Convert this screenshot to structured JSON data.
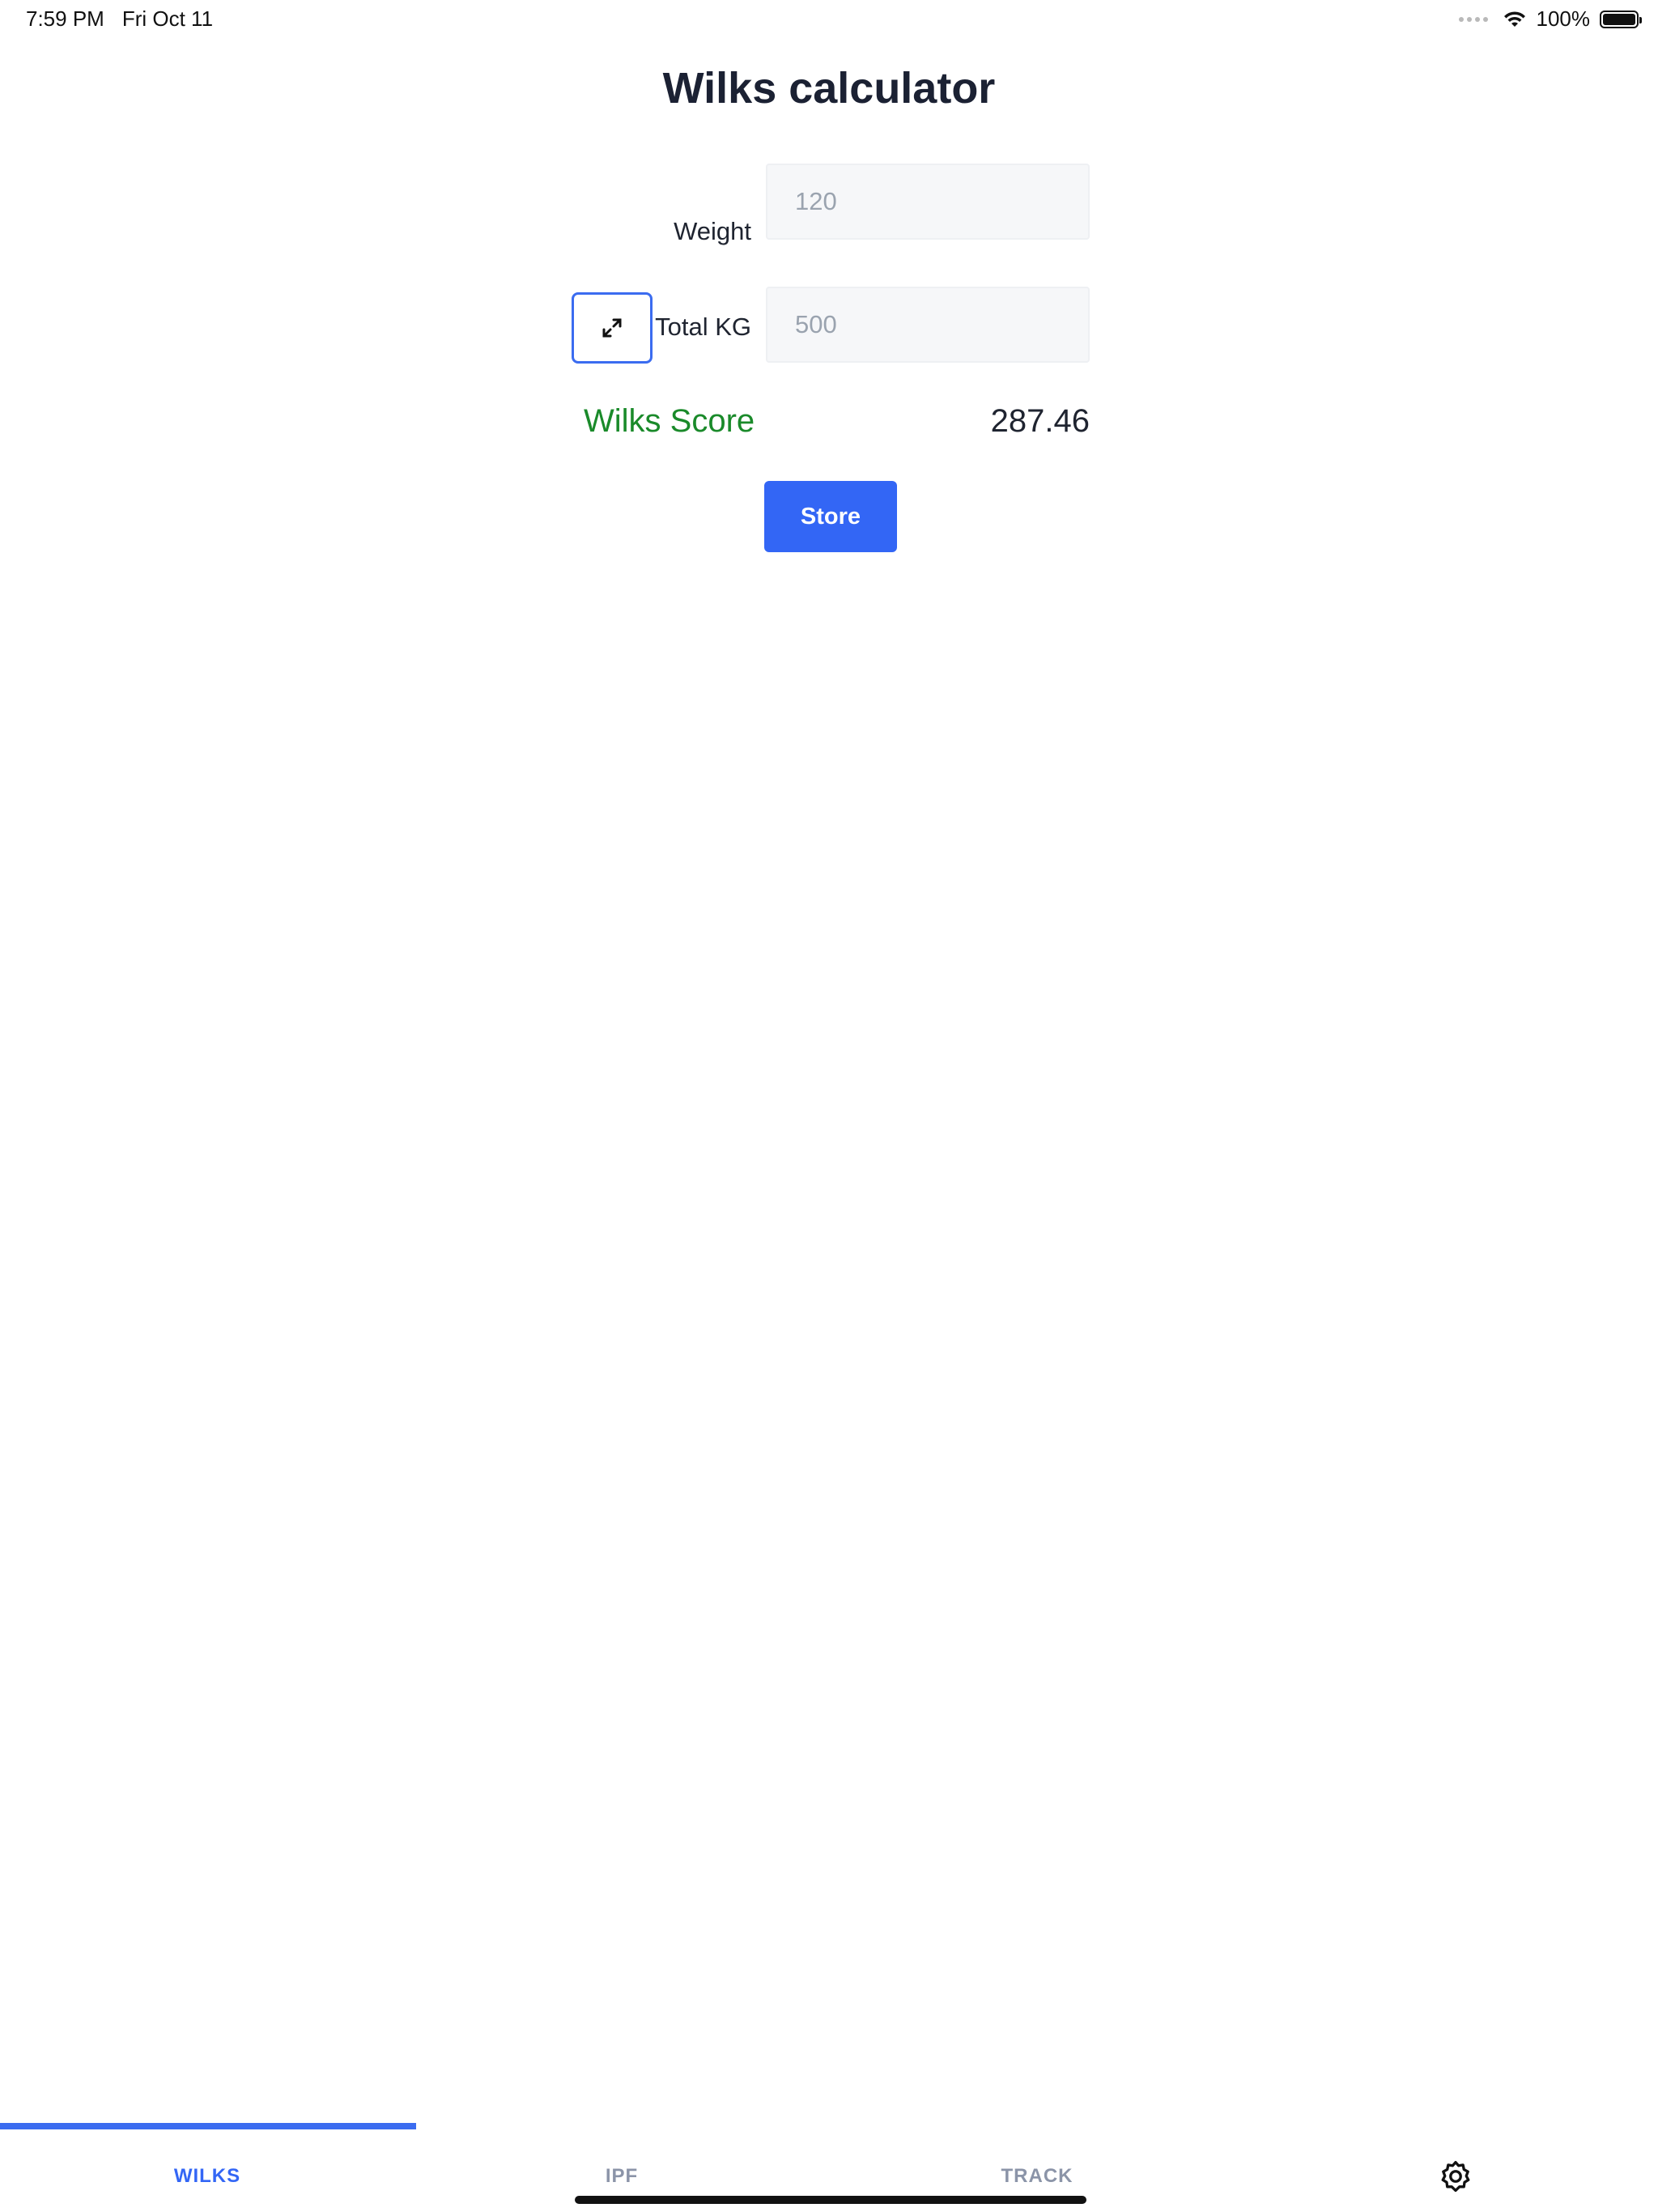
{
  "status_bar": {
    "time": "7:59 PM",
    "date": "Fri Oct 11",
    "battery": "100%",
    "icons": [
      "signal-dots-icon",
      "wifi-icon",
      "battery-icon"
    ]
  },
  "page": {
    "title": "Wilks calculator"
  },
  "form": {
    "weight": {
      "label": "Weight",
      "placeholder": "120"
    },
    "total": {
      "label": "Total KG",
      "placeholder": "500",
      "toggle_icon": "expand-arrows-icon"
    }
  },
  "result": {
    "label": "Wilks Score",
    "value": "287.46",
    "label_color": "#1a8a2a"
  },
  "actions": {
    "store_label": "Store",
    "store_color": "#3366f5"
  },
  "tabs": {
    "items": [
      {
        "label": "WILKS",
        "active": true
      },
      {
        "label": "IPF",
        "active": false
      },
      {
        "label": "TRACK",
        "active": false
      }
    ],
    "settings_icon": "gear-icon",
    "active_color": "#3366f5",
    "inactive_color": "#8b94a8"
  }
}
